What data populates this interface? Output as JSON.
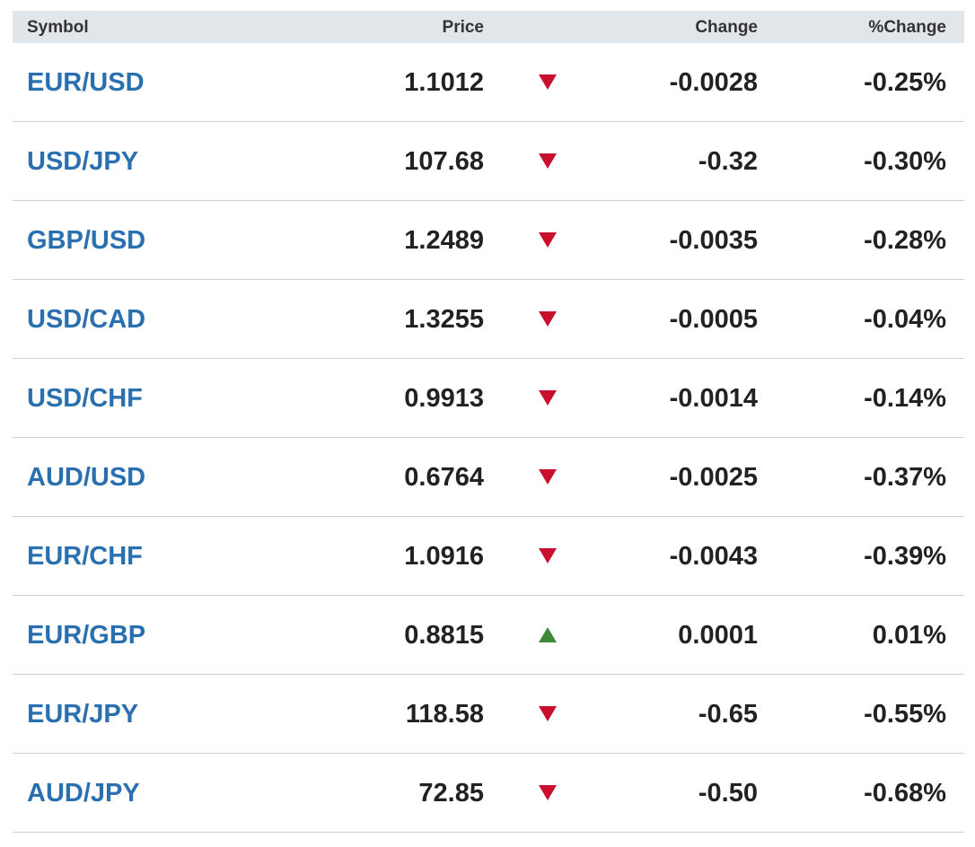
{
  "table": {
    "headers": {
      "symbol": "Symbol",
      "price": "Price",
      "change": "Change",
      "pct_change": "%Change"
    },
    "colors": {
      "link": "#2a70b0",
      "down_arrow": "#c8102e",
      "up_arrow": "#3d8b37",
      "header_bg": "#e1e6ea"
    },
    "rows": [
      {
        "symbol": "EUR/USD",
        "price": "1.1012",
        "direction": "down",
        "change": "-0.0028",
        "pct_change": "-0.25%"
      },
      {
        "symbol": "USD/JPY",
        "price": "107.68",
        "direction": "down",
        "change": "-0.32",
        "pct_change": "-0.30%"
      },
      {
        "symbol": "GBP/USD",
        "price": "1.2489",
        "direction": "down",
        "change": "-0.0035",
        "pct_change": "-0.28%"
      },
      {
        "symbol": "USD/CAD",
        "price": "1.3255",
        "direction": "down",
        "change": "-0.0005",
        "pct_change": "-0.04%"
      },
      {
        "symbol": "USD/CHF",
        "price": "0.9913",
        "direction": "down",
        "change": "-0.0014",
        "pct_change": "-0.14%"
      },
      {
        "symbol": "AUD/USD",
        "price": "0.6764",
        "direction": "down",
        "change": "-0.0025",
        "pct_change": "-0.37%"
      },
      {
        "symbol": "EUR/CHF",
        "price": "1.0916",
        "direction": "down",
        "change": "-0.0043",
        "pct_change": "-0.39%"
      },
      {
        "symbol": "EUR/GBP",
        "price": "0.8815",
        "direction": "up",
        "change": "0.0001",
        "pct_change": "0.01%"
      },
      {
        "symbol": "EUR/JPY",
        "price": "118.58",
        "direction": "down",
        "change": "-0.65",
        "pct_change": "-0.55%"
      },
      {
        "symbol": "AUD/JPY",
        "price": "72.85",
        "direction": "down",
        "change": "-0.50",
        "pct_change": "-0.68%"
      }
    ]
  }
}
